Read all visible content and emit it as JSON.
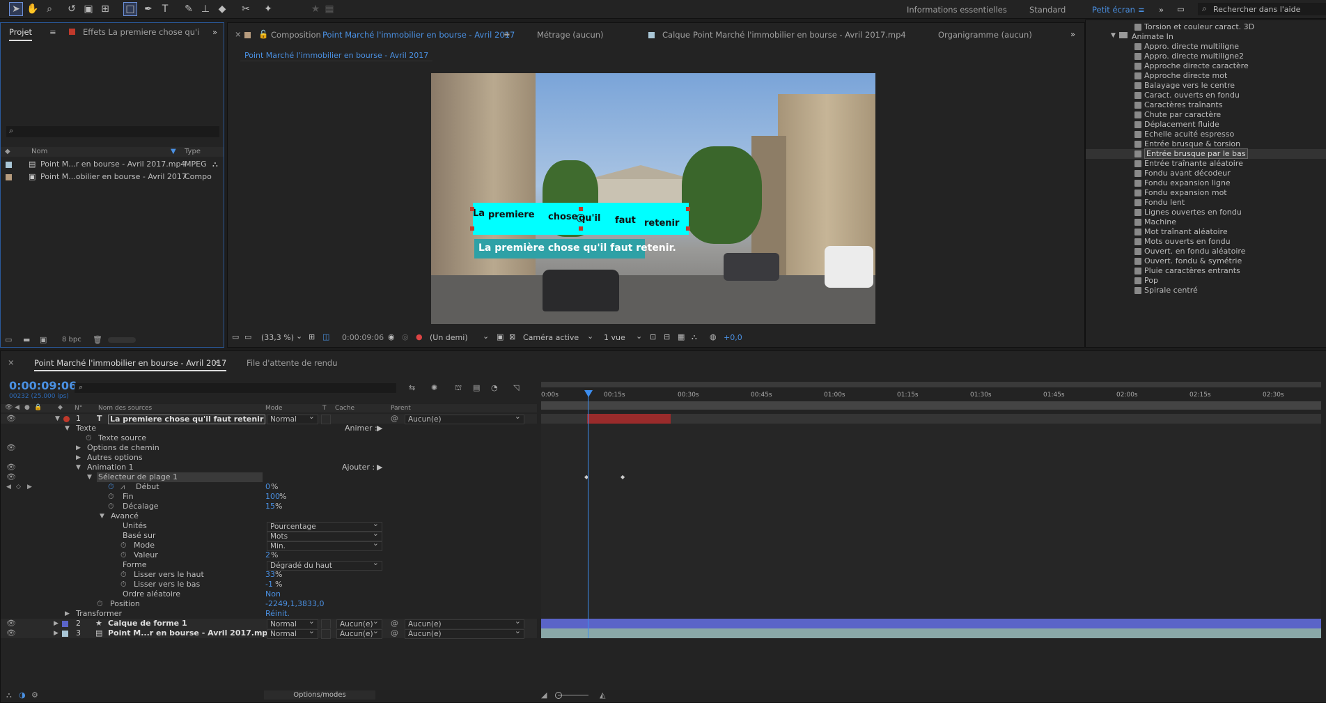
{
  "toolbar": {
    "workspaces": [
      "Informations essentielles",
      "Standard",
      "Petit écran"
    ],
    "active_workspace": "Petit écran",
    "search_placeholder": "Rechercher dans l'aide"
  },
  "project_panel": {
    "tab_label": "Projet",
    "effects_tab": "Effets La premiere chose qu'il f",
    "col_name": "Nom",
    "col_type": "Type",
    "items": [
      {
        "name": "Point M...r en bourse - Avril 2017.mp4",
        "type": "MPEG",
        "color": "#a9c6d6"
      },
      {
        "name": "Point M...obilier en bourse - Avril 2017",
        "type": "Compo",
        "color": "#b79c7e"
      }
    ],
    "bpc": "8 bpc"
  },
  "comp_panel": {
    "tab_prefix": "Composition",
    "tab_name": "Point Marché  l'immobilier en bourse - Avril 2017",
    "footage_tab": "Métrage  (aucun)",
    "layer_tab_prefix": "Calque",
    "layer_tab_name": "Point Marché  l'immobilier en bourse - Avril 2017.mp4",
    "flowchart_tab": "Organigramme  (aucun)",
    "breadcrumb": "Point Marché  l'immobilier en bourse - Avril 2017",
    "text_overlay": [
      "La",
      "premiere",
      "chose",
      "qu'il",
      "faut",
      "retenir"
    ],
    "subtitle": "La première chose qu'il faut retenir.",
    "zoom": "(33,3 %)",
    "timecode": "0:00:09:06",
    "resolution": "(Un demi)",
    "camera": "Caméra active",
    "views": "1 vue",
    "exposure": "+0,0"
  },
  "effects_panel": {
    "top_item": "Torsion et couleur caract. 3D",
    "folder": "Animate In",
    "items": [
      "Appro. directe multiligne",
      "Appro. directe multiligne2",
      "Approche directe caractère",
      "Approche directe mot",
      "Balayage vers le centre",
      "Caract. ouverts en fondu",
      "Caractères traînants",
      "Chute par caractère",
      "Déplacement fluide",
      "Echelle acuité espresso",
      "Entrée brusque & torsion",
      "Entrée brusque par le bas",
      "Entrée traînante aléatoire",
      "Fondu avant décodeur",
      "Fondu expansion ligne",
      "Fondu expansion mot",
      "Fondu lent",
      "Lignes ouvertes en fondu",
      "Machine",
      "Mot traînant aléatoire",
      "Mots ouverts en fondu",
      "Ouvert. en fondu aléatoire",
      "Ouvert. fondu & symétrie",
      "Pluie caractères entrants",
      "Pop",
      "Spirale centré"
    ],
    "selected": "Entrée brusque par le bas"
  },
  "timeline": {
    "tab_name": "Point Marché  l'immobilier en bourse - Avril 2017",
    "render_queue": "File d'attente de rendu",
    "timecode": "0:00:09:06",
    "frames": "00232 (25.000 ips)",
    "col_num": "N°",
    "col_source": "Nom des sources",
    "col_mode": "Mode",
    "col_t": "T",
    "col_cache": "Cache",
    "col_parent": "Parent",
    "ruler": [
      "0:00s",
      "00:15s",
      "00:30s",
      "00:45s",
      "01:00s",
      "01:15s",
      "01:30s",
      "01:45s",
      "02:00s",
      "02:15s",
      "02:30s"
    ],
    "layer1": {
      "num": "1",
      "name": "La premiere chose qu'il faut retenir",
      "mode": "Normal",
      "parent": "Aucun(e)"
    },
    "props": {
      "texte": "Texte",
      "animer": "Animer :",
      "texte_source": "Texte source",
      "options_chemin": "Options de chemin",
      "autres_options": "Autres options",
      "animation1": "Animation 1",
      "ajouter": "Ajouter :",
      "selecteur": "Sélecteur de plage 1",
      "debut": "Début",
      "debut_val": "0",
      "fin": "Fin",
      "fin_val": "100",
      "decalage": "Décalage",
      "decalage_val": "15",
      "avance": "Avancé",
      "unites": "Unités",
      "unites_val": "Pourcentage",
      "base_sur": "Basé sur",
      "base_sur_val": "Mots",
      "mode": "Mode",
      "mode_val": "Min.",
      "valeur": "Valeur",
      "valeur_val": "2",
      "forme": "Forme",
      "forme_val": "Dégradé du haut",
      "lisser_haut": "Lisser vers le haut",
      "lisser_haut_val": "33",
      "lisser_bas": "Lisser vers le bas",
      "lisser_bas_val": "-1",
      "ordre": "Ordre aléatoire",
      "ordre_val": "Non",
      "position": "Position",
      "position_val": "-2249,1,3833,0",
      "transformer": "Transformer",
      "reinit": "Réinit.",
      "pct": "%"
    },
    "layer2": {
      "num": "2",
      "name": "Calque de forme 1",
      "mode": "Normal",
      "cache": "Aucun(e)",
      "parent": "Aucun(e)"
    },
    "layer3": {
      "num": "3",
      "name": "Point M...r en bourse - Avril 2017.mp4",
      "mode": "Normal",
      "cache": "Aucun(e)",
      "parent": "Aucun(e)"
    },
    "options_modes": "Options/modes"
  }
}
